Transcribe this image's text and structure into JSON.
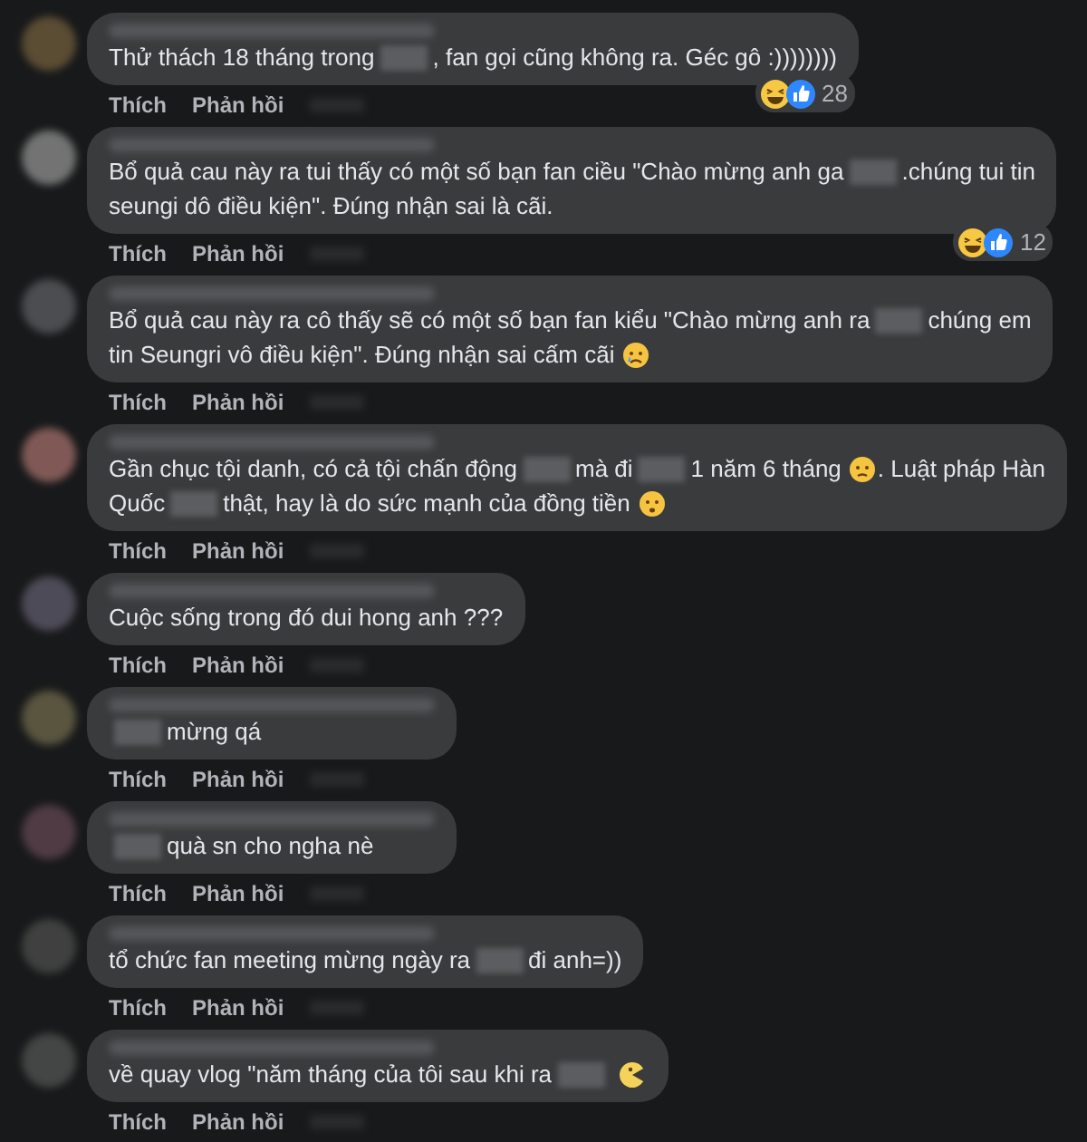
{
  "comments": [
    {
      "lines": [
        [
          {
            "kind": "text",
            "text": "Thử thách 18 tháng trong"
          },
          {
            "kind": "redacted"
          },
          {
            "kind": "text",
            "text": ", fan gọi cũng không ra. Géc gô :))))))))"
          }
        ]
      ],
      "reactions": {
        "count": "28"
      },
      "actions": [
        "Thích",
        "Phản hồi"
      ]
    },
    {
      "lines": [
        [
          {
            "kind": "text",
            "text": "Bổ quả cau này ra tui thấy có một số bạn fan ciều \"Chào mừng anh ga"
          },
          {
            "kind": "redacted"
          },
          {
            "kind": "text",
            "text": ".chúng tui tin"
          }
        ],
        [
          {
            "kind": "text",
            "text": "seungi dô điều kiện\". Đúng nhận sai là cãi."
          }
        ]
      ],
      "reactions": {
        "count": "12"
      },
      "actions": [
        "Thích",
        "Phản hồi"
      ]
    },
    {
      "lines": [
        [
          {
            "kind": "text",
            "text": "Bổ quả cau này ra cô thấy sẽ có một số bạn fan kiểu \"Chào mừng anh ra"
          },
          {
            "kind": "redacted"
          },
          {
            "kind": "text",
            "text": "chúng em"
          }
        ],
        [
          {
            "kind": "text",
            "text": "tin Seungri vô điều kiện\". Đúng nhận sai cấm cãi"
          },
          {
            "kind": "crying-emoji"
          }
        ]
      ],
      "actions": [
        "Thích",
        "Phản hồi"
      ]
    },
    {
      "lines": [
        [
          {
            "kind": "text",
            "text": "Gần chục tội danh, có cả tội chấn động"
          },
          {
            "kind": "redacted"
          },
          {
            "kind": "text",
            "text": "mà đi"
          },
          {
            "kind": "redacted"
          },
          {
            "kind": "text",
            "text": "1 năm 6 tháng"
          },
          {
            "kind": "sad-emoji"
          },
          {
            "kind": "text",
            "text": ". Luật pháp Hàn"
          }
        ],
        [
          {
            "kind": "text",
            "text": "Quốc"
          },
          {
            "kind": "redacted"
          },
          {
            "kind": "text",
            "text": "thật, hay là do sức mạnh của đồng tiền"
          },
          {
            "kind": "worried-emoji"
          }
        ]
      ],
      "actions": [
        "Thích",
        "Phản hồi"
      ]
    },
    {
      "lines": [
        [
          {
            "kind": "text",
            "text": "Cuộc sống trong đó dui hong anh ???"
          }
        ]
      ],
      "actions": [
        "Thích",
        "Phản hồi"
      ]
    },
    {
      "lines": [
        [
          {
            "kind": "redacted"
          },
          {
            "kind": "text",
            "text": "mừng qá"
          }
        ]
      ],
      "actions": [
        "Thích",
        "Phản hồi"
      ]
    },
    {
      "lines": [
        [
          {
            "kind": "redacted"
          },
          {
            "kind": "text",
            "text": "quà sn cho ngha nè"
          }
        ]
      ],
      "actions": [
        "Thích",
        "Phản hồi"
      ]
    },
    {
      "lines": [
        [
          {
            "kind": "text",
            "text": "tổ chức fan meeting mừng ngày ra"
          },
          {
            "kind": "redacted"
          },
          {
            "kind": "text",
            "text": "đi anh=))"
          }
        ]
      ],
      "actions": [
        "Thích",
        "Phản hồi"
      ]
    },
    {
      "lines": [
        [
          {
            "kind": "text",
            "text": "về quay vlog \"năm tháng của tôi sau khi ra"
          },
          {
            "kind": "redacted"
          },
          {
            "kind": "chomp-emoji"
          }
        ]
      ],
      "actions": [
        "Thích",
        "Phản hồi"
      ]
    }
  ]
}
